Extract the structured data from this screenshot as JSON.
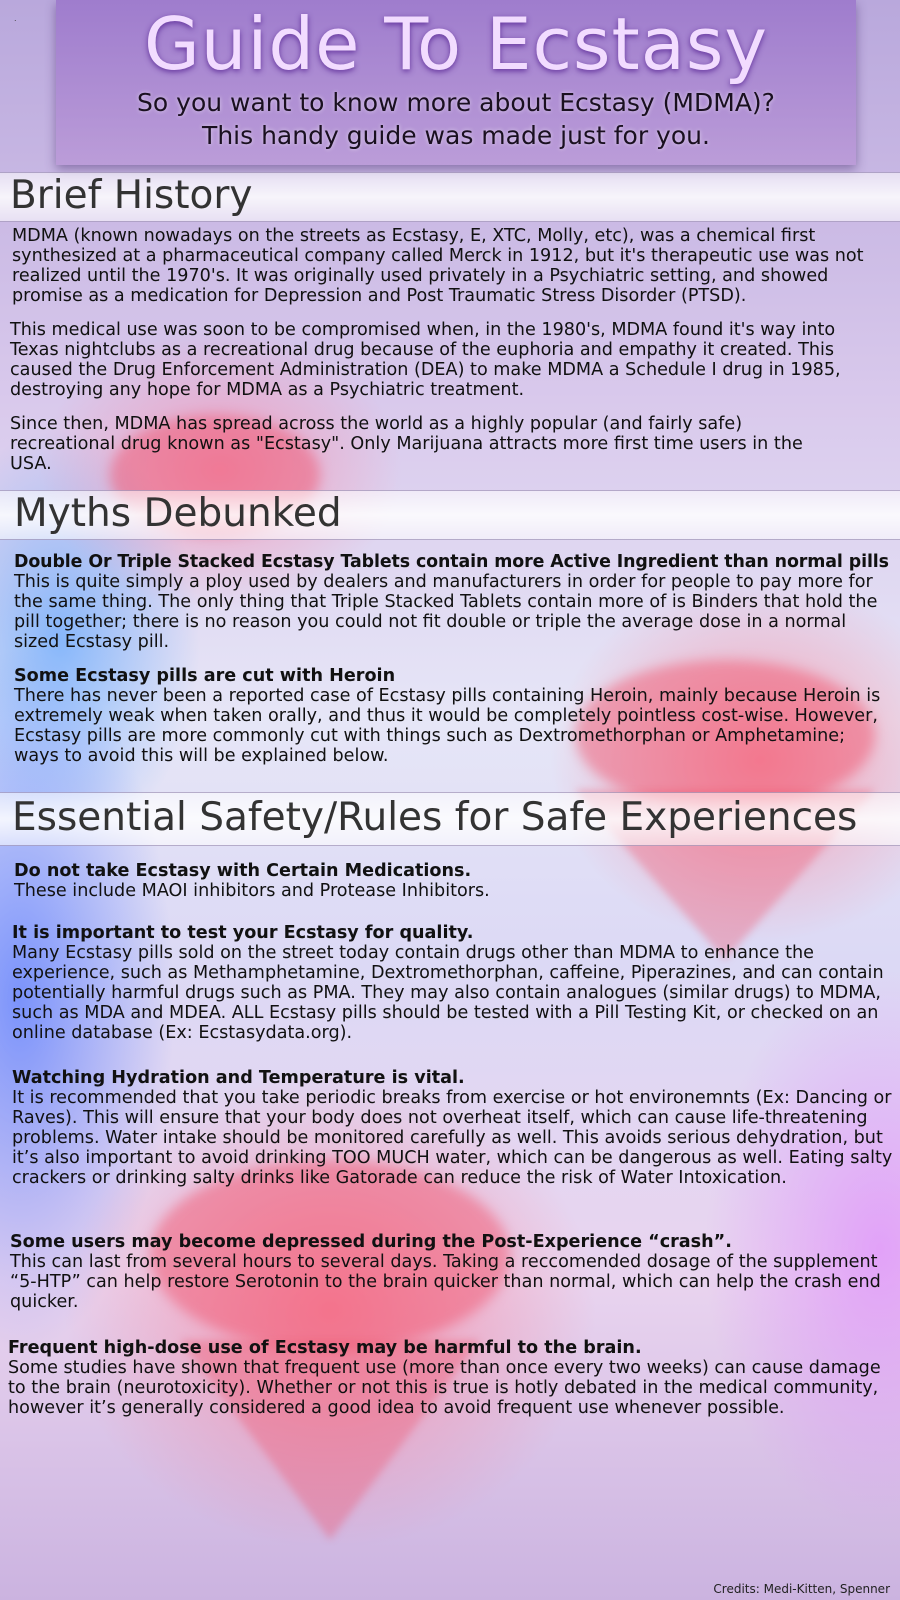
{
  "header": {
    "title": "Guide To Ecstasy",
    "subtitle_line1": "So you want to know more about Ecstasy (MDMA)?",
    "subtitle_line2": "This handy guide was made just for you.",
    "corner_mark": "."
  },
  "history": {
    "title": "Brief History",
    "p1": "MDMA (known nowadays on the streets as Ecstasy, E, XTC, Molly, etc), was a chemical first synthesized at a pharmaceutical company called Merck in 1912, but it's therapeutic use was not realized until the 1970's. It was originally used privately in a Psychiatric setting, and showed promise as a medication for Depression and Post Traumatic Stress Disorder (PTSD).",
    "p2": "This medical use was soon to be compromised when, in the 1980's, MDMA found it's way into Texas nightclubs as a recreational drug because of the euphoria and empathy it created. This caused the Drug Enforcement Administration (DEA) to make MDMA a Schedule I drug in 1985, destroying any hope for MDMA as a Psychiatric treatment.",
    "p3": "Since then, MDMA has spread across the world as a highly popular (and fairly safe) recreational drug known as \"Ecstasy\". Only Marijuana attracts more first time users in the USA."
  },
  "myths": {
    "title": "Myths Debunked",
    "items": [
      {
        "heading": "Double Or Triple Stacked Ecstasy Tablets contain more Active Ingredient than normal pills",
        "body": "This is quite simply a ploy used by dealers and manufacturers in order for people to pay more for the same thing. The only thing that Triple Stacked Tablets contain more of is Binders that hold the pill together; there is no reason you could not fit double or triple the average dose in a normal sized Ecstasy pill."
      },
      {
        "heading": "Some Ecstasy pills are cut with Heroin",
        "body": "There has never been a reported case of Ecstasy pills containing Heroin, mainly because Heroin is extremely weak when taken orally, and thus it would be completely pointless cost-wise. However, Ecstasy pills are more commonly cut with things such as Dextromethorphan or Amphetamine; ways to avoid this will be explained below."
      }
    ]
  },
  "safety": {
    "title": "Essential Safety/Rules for Safe Experiences",
    "items": [
      {
        "heading": "Do not take Ecstasy with Certain Medications.",
        "body": "These include MAOI inhibitors and Protease Inhibitors."
      },
      {
        "heading": "It is important to test your Ecstasy for quality.",
        "body": "Many Ecstasy pills sold on the street today contain drugs other than MDMA to enhance the experience, such as Methamphetamine, Dextromethorphan, caffeine, Piperazines, and can contain potentially harmful drugs such as PMA. They may also contain analogues (similar drugs) to MDMA, such as MDA and MDEA. ALL Ecstasy pills should be tested with a Pill Testing Kit, or checked on an online database (Ex: Ecstasydata.org)."
      },
      {
        "heading": "Watching Hydration and Temperature is vital.",
        "body": "It is recommended that you take periodic breaks from exercise or hot environemnts (Ex: Dancing or Raves). This will ensure that your body does not overheat itself, which can cause life-threatening problems. Water intake should be monitored carefully as well. This avoids serious dehydration, but it’s also important to avoid drinking TOO MUCH water, which can be dangerous as well. Eating salty crackers or drinking salty drinks like Gatorade can reduce the risk of Water Intoxication."
      },
      {
        "heading": "Some users may become depressed during the Post-Experience “crash”.",
        "body": "This can last from several hours to several days. Taking a reccomended dosage of the supplement “5-HTP” can help restore Serotonin to the brain quicker than normal, which can help the crash end quicker."
      },
      {
        "heading": "Frequent high-dose use of Ecstasy may be harmful to the brain.",
        "body": "Some studies have shown that frequent use (more than once every two weeks) can cause damage to the brain (neurotoxicity). Whether or not this is true is hotly debated in the medical community, however it’s generally considered a good idea to avoid frequent use whenever possible."
      }
    ]
  },
  "footer": {
    "credits": "Credits: Medi-Kitten, Spenner"
  }
}
